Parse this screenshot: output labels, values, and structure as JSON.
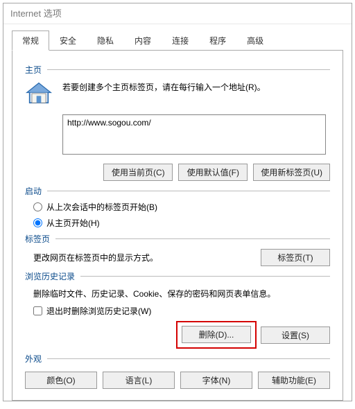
{
  "window": {
    "title": "Internet 选项"
  },
  "tabs": {
    "items": [
      {
        "label": "常规"
      },
      {
        "label": "安全"
      },
      {
        "label": "隐私"
      },
      {
        "label": "内容"
      },
      {
        "label": "连接"
      },
      {
        "label": "程序"
      },
      {
        "label": "高级"
      }
    ]
  },
  "home": {
    "legend": "主页",
    "hint": "若要创建多个主页标签页，请在每行输入一个地址(R)。",
    "url_value": "http://www.sogou.com/",
    "use_current": "使用当前页(C)",
    "use_default": "使用默认值(F)",
    "use_newtab": "使用新标签页(U)"
  },
  "startup": {
    "legend": "启动",
    "opt_lastsession": "从上次会话中的标签页开始(B)",
    "opt_homepage": "从主页开始(H)"
  },
  "tabsection": {
    "legend": "标签页",
    "desc": "更改网页在标签页中的显示方式。",
    "btn": "标签页(T)"
  },
  "history": {
    "legend": "浏览历史记录",
    "desc": "删除临时文件、历史记录、Cookie、保存的密码和网页表单信息。",
    "check_exit_delete": "退出时删除浏览历史记录(W)",
    "btn_delete": "删除(D)...",
    "btn_settings": "设置(S)"
  },
  "appearance": {
    "legend": "外观",
    "btn_color": "颜色(O)",
    "btn_lang": "语言(L)",
    "btn_font": "字体(N)",
    "btn_access": "辅助功能(E)"
  }
}
